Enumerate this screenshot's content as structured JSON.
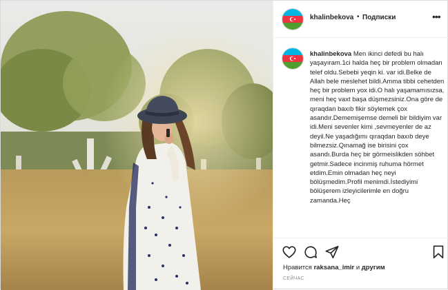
{
  "header": {
    "username": "khalinbekova",
    "dot": "•",
    "follow_label": "Подписки",
    "more_icon": "more-horizontal-icon"
  },
  "caption": {
    "username": "khalinbekova",
    "text": "Men ikinci defedi bu halı yaşayıram.1ci halda heç bir problem olmadan telef oldu.Sebebi yeqin ki. var idi.Belke de Allah bele meslehet bildi.Amma tibbi cehetden heç bir problem yox idi.O halı yaşamamısızsa, meni heç vaxt başa düşmezsiniz.Ona göre de qıraqdan baxıb fikir söylemek çox asandır.Dememişemse demeli bir bildiyim var idi.Meni sevenler kimi ,sevmeyenler de az deyil.Ne yaşadığımı qıraqdan baxıb deye bilmezsiz.Qınamağ ise birisini çox asandı.Burda heç bir görmeislikden söhbet getmir.Sadece incinmiş ruhuma hörmet etdim.Emin olmadan heç neyi bölüşmedim.Profil menimdi.İstediyimi bölüşerem izleyicilerimle en doğru zamanda.Heç"
  },
  "actions": {
    "like_icon": "heart-icon",
    "comment_icon": "comment-icon",
    "share_icon": "share-icon",
    "save_icon": "bookmark-icon"
  },
  "likes": {
    "prefix": "Нравится ",
    "user": "raksana_imir",
    "middle": " и ",
    "others": "другим"
  },
  "time_label": "СЕЙЧАС",
  "colors": {
    "text": "#262626",
    "muted": "#8e8e8e",
    "border": "#dbdbdb",
    "flag_blue": "#00b5e2",
    "flag_red": "#ef3340",
    "flag_green": "#509e2f"
  }
}
